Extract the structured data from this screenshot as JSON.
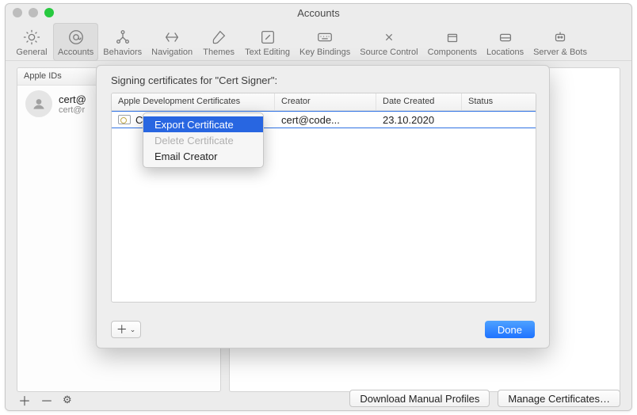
{
  "window": {
    "title": "Accounts"
  },
  "toolbar": [
    {
      "key": "general",
      "label": "General",
      "icon": "gear"
    },
    {
      "key": "accounts",
      "label": "Accounts",
      "icon": "at",
      "active": true
    },
    {
      "key": "behaviors",
      "label": "Behaviors",
      "icon": "nodes"
    },
    {
      "key": "navigation",
      "label": "Navigation",
      "icon": "arrows"
    },
    {
      "key": "themes",
      "label": "Themes",
      "icon": "brush"
    },
    {
      "key": "text-editing",
      "label": "Text Editing",
      "icon": "pencil"
    },
    {
      "key": "key-bindings",
      "label": "Key Bindings",
      "icon": "keyboard"
    },
    {
      "key": "source-control",
      "label": "Source Control",
      "icon": "branch"
    },
    {
      "key": "components",
      "label": "Components",
      "icon": "package"
    },
    {
      "key": "locations",
      "label": "Locations",
      "icon": "drive"
    },
    {
      "key": "server",
      "label": "Server & Bots",
      "icon": "robot"
    }
  ],
  "sidebar": {
    "header": "Apple IDs",
    "item": {
      "line1": "cert@",
      "line2": "cert@r"
    }
  },
  "main_footer": {
    "download": "Download Manual Profiles",
    "manage": "Manage Certificates…"
  },
  "sheet": {
    "title": "Signing certificates for \"Cert Signer\":",
    "columns": {
      "c1": "Apple Development Certificates",
      "c2": "Creator",
      "c3": "Date Created",
      "c4": "Status"
    },
    "row": {
      "name": "Ce",
      "creator": "cert@code...",
      "date": "23.10.2020",
      "status": ""
    },
    "done": "Done"
  },
  "ctx": {
    "export": "Export Certificate",
    "delete": "Delete Certificate",
    "email": "Email Creator"
  }
}
